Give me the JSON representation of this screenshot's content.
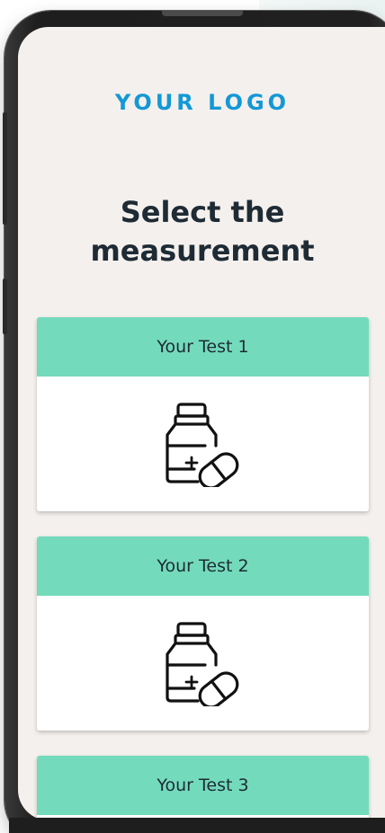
{
  "logo": "YOUR LOGO",
  "heading": "Select the measurement",
  "tests": [
    {
      "label": "Your Test 1",
      "icon": "medicine-bottle-pill-icon"
    },
    {
      "label": "Your Test 2",
      "icon": "medicine-bottle-pill-icon"
    },
    {
      "label": "Your Test 3",
      "icon": "medicine-bottle-pill-icon"
    }
  ],
  "colors": {
    "brand": "#1398d6",
    "card_header": "#73dbbb",
    "screen_bg": "#f4f0ed",
    "text_dark": "#1e2b35"
  }
}
